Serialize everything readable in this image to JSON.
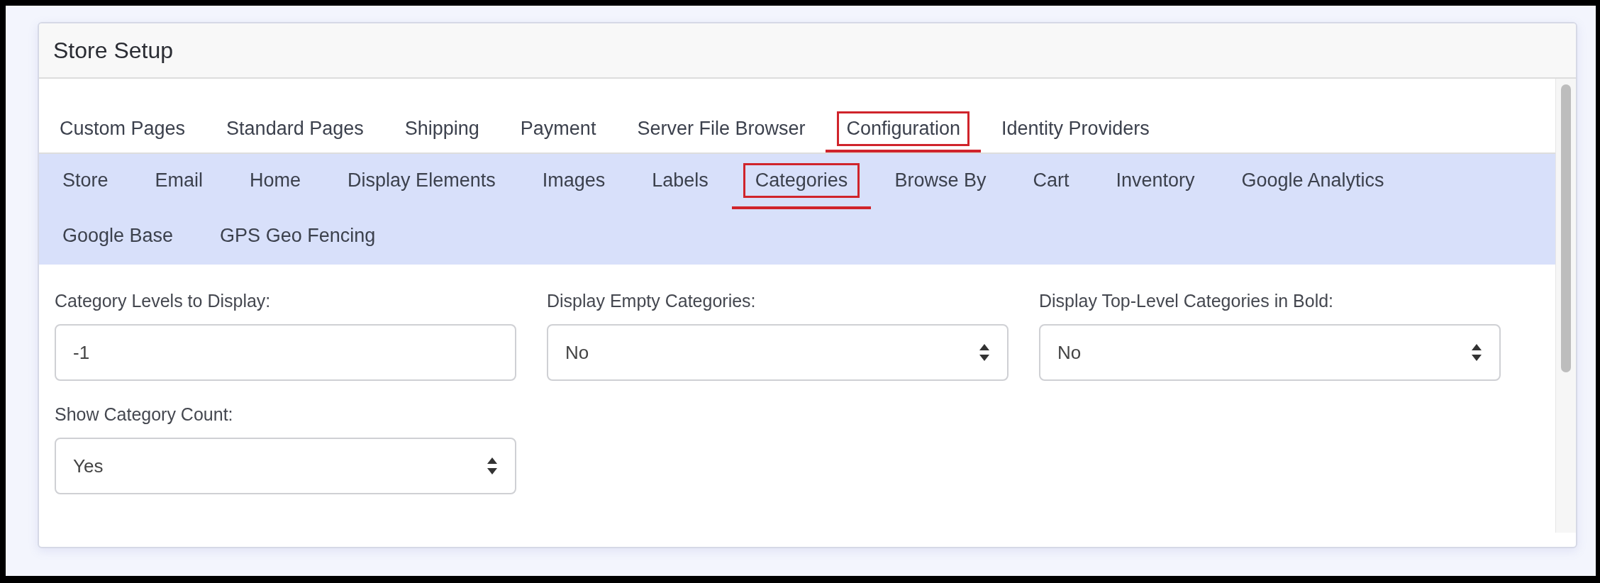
{
  "panel": {
    "title": "Store Setup"
  },
  "tabs": [
    {
      "label": "Custom Pages",
      "selected": false
    },
    {
      "label": "Standard Pages",
      "selected": false
    },
    {
      "label": "Shipping",
      "selected": false
    },
    {
      "label": "Payment",
      "selected": false
    },
    {
      "label": "Server File Browser",
      "selected": false
    },
    {
      "label": "Configuration",
      "selected": true
    },
    {
      "label": "Identity Providers",
      "selected": false
    }
  ],
  "subtabs": [
    {
      "label": "Store",
      "selected": false
    },
    {
      "label": "Email",
      "selected": false
    },
    {
      "label": "Home",
      "selected": false
    },
    {
      "label": "Display Elements",
      "selected": false
    },
    {
      "label": "Images",
      "selected": false
    },
    {
      "label": "Labels",
      "selected": false
    },
    {
      "label": "Categories",
      "selected": true
    },
    {
      "label": "Browse By",
      "selected": false
    },
    {
      "label": "Cart",
      "selected": false
    },
    {
      "label": "Inventory",
      "selected": false
    },
    {
      "label": "Google Analytics",
      "selected": false
    },
    {
      "label": "Google Base",
      "selected": false
    },
    {
      "label": "GPS Geo Fencing",
      "selected": false
    }
  ],
  "fields": [
    {
      "kind": "text",
      "label": "Category Levels to Display:",
      "value": "-1"
    },
    {
      "kind": "select",
      "label": "Display Empty Categories:",
      "value": "No"
    },
    {
      "kind": "select",
      "label": "Display Top-Level Categories in Bold:",
      "value": "No"
    },
    {
      "kind": "select",
      "label": "Show Category Count:",
      "value": "Yes"
    }
  ]
}
